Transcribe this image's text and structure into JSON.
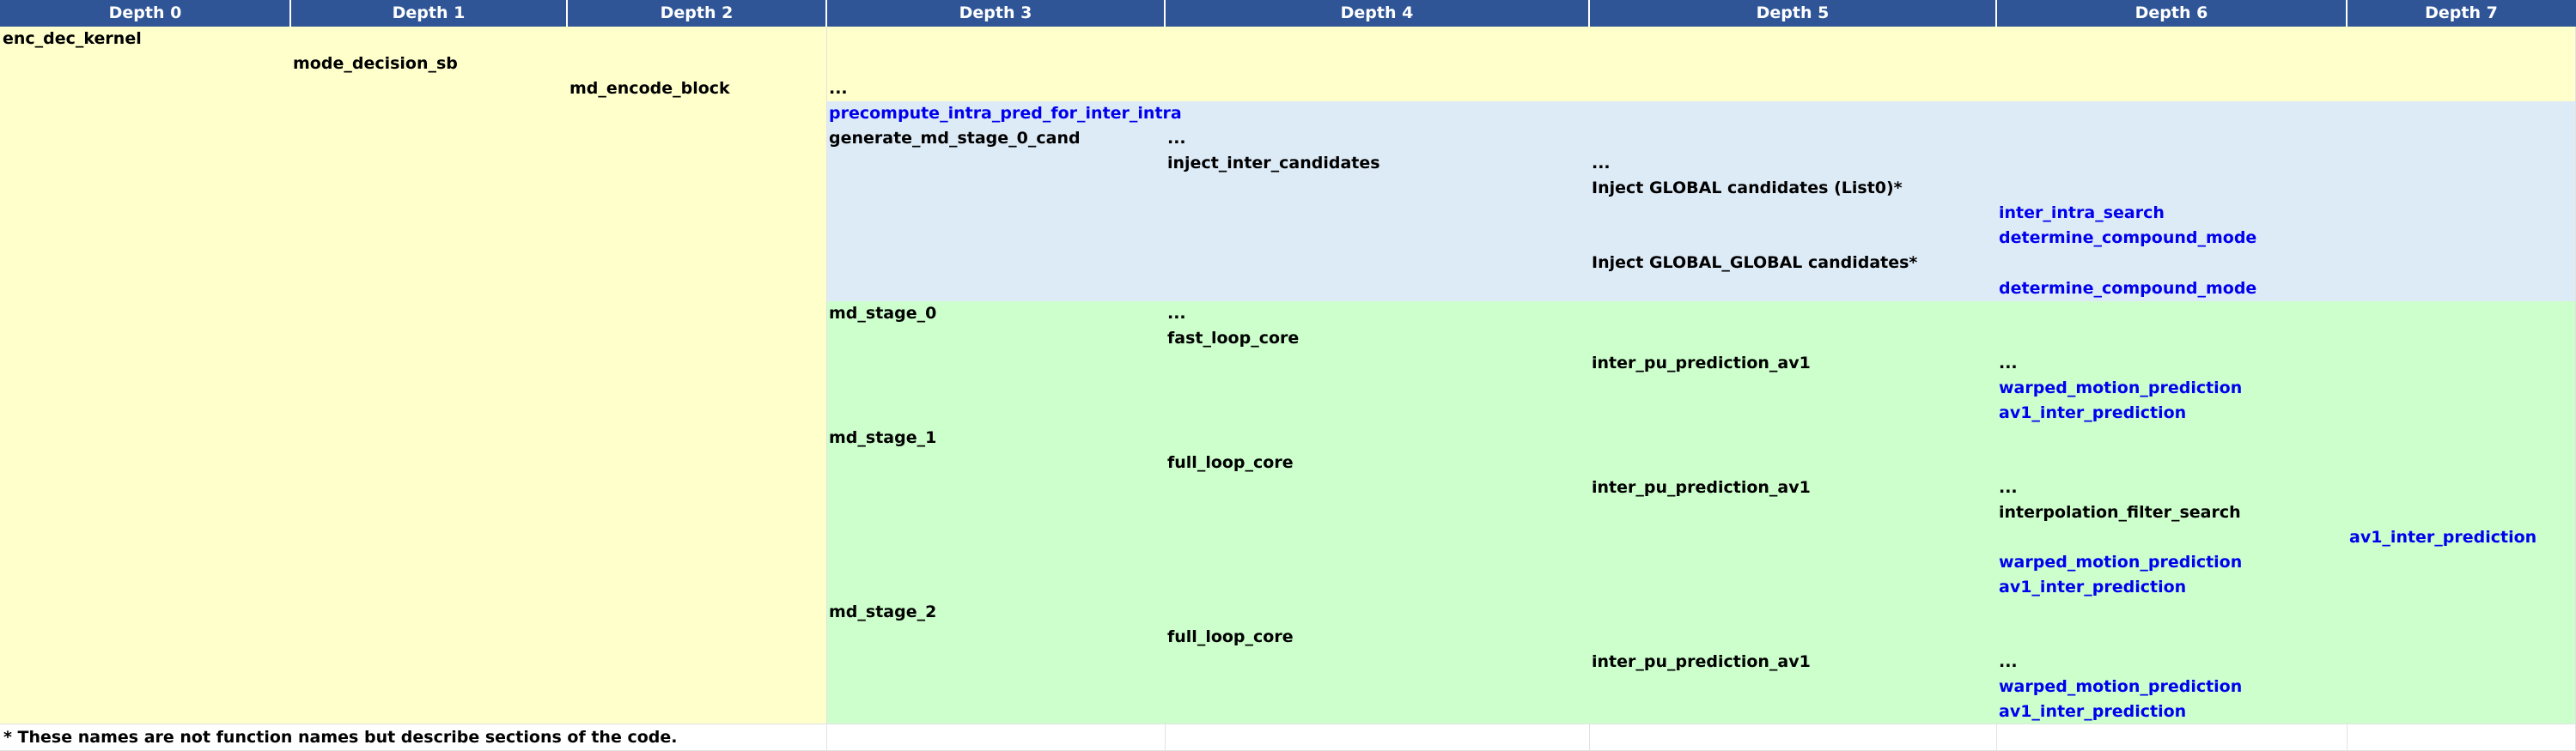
{
  "headers": [
    "Depth 0",
    "Depth 1",
    "Depth 2",
    "Depth 3",
    "Depth 4",
    "Depth 5",
    "Depth 6",
    "Depth 7"
  ],
  "colors": {
    "header_bg": "#2f5597",
    "header_text": "#ffffff",
    "yellow_bg": "#ffffcc",
    "blue_bg": "#ddebf7",
    "green_bg": "#ccffcc",
    "black_text": "#000000",
    "blue_text": "#0000ee"
  },
  "cells": [
    {
      "text": "enc_dec_kernel",
      "depth": 0,
      "row": 1,
      "color": "black"
    },
    {
      "text": "mode_decision_sb",
      "depth": 1,
      "row": 2,
      "color": "black"
    },
    {
      "text": "md_encode_block",
      "depth": 2,
      "row": 3,
      "color": "black"
    },
    {
      "text": "...",
      "depth": 3,
      "row": 3,
      "color": "black"
    },
    {
      "text": "precompute_intra_pred_for_inter_intra",
      "depth": 3,
      "row": 4,
      "color": "blue"
    },
    {
      "text": "generate_md_stage_0_cand",
      "depth": 3,
      "row": 5,
      "color": "black"
    },
    {
      "text": "...",
      "depth": 4,
      "row": 5,
      "color": "black"
    },
    {
      "text": "inject_inter_candidates",
      "depth": 4,
      "row": 6,
      "color": "black"
    },
    {
      "text": "...",
      "depth": 5,
      "row": 6,
      "color": "black"
    },
    {
      "text": "Inject GLOBAL candidates (List0)*",
      "depth": 5,
      "row": 7,
      "color": "black"
    },
    {
      "text": "inter_intra_search",
      "depth": 6,
      "row": 8,
      "color": "blue"
    },
    {
      "text": "determine_compound_mode",
      "depth": 6,
      "row": 9,
      "color": "blue"
    },
    {
      "text": "Inject GLOBAL_GLOBAL candidates*",
      "depth": 5,
      "row": 10,
      "color": "black"
    },
    {
      "text": "determine_compound_mode",
      "depth": 6,
      "row": 11,
      "color": "blue"
    },
    {
      "text": "md_stage_0",
      "depth": 3,
      "row": 12,
      "color": "black"
    },
    {
      "text": "...",
      "depth": 4,
      "row": 12,
      "color": "black"
    },
    {
      "text": "fast_loop_core",
      "depth": 4,
      "row": 13,
      "color": "black"
    },
    {
      "text": "inter_pu_prediction_av1",
      "depth": 5,
      "row": 14,
      "color": "black"
    },
    {
      "text": "...",
      "depth": 6,
      "row": 14,
      "color": "black"
    },
    {
      "text": "warped_motion_prediction",
      "depth": 6,
      "row": 15,
      "color": "blue"
    },
    {
      "text": "av1_inter_prediction",
      "depth": 6,
      "row": 16,
      "color": "blue"
    },
    {
      "text": "md_stage_1",
      "depth": 3,
      "row": 17,
      "color": "black"
    },
    {
      "text": "full_loop_core",
      "depth": 4,
      "row": 18,
      "color": "black"
    },
    {
      "text": "inter_pu_prediction_av1",
      "depth": 5,
      "row": 19,
      "color": "black"
    },
    {
      "text": "...",
      "depth": 6,
      "row": 19,
      "color": "black"
    },
    {
      "text": "interpolation_filter_search",
      "depth": 6,
      "row": 20,
      "color": "black"
    },
    {
      "text": "av1_inter_prediction",
      "depth": 7,
      "row": 21,
      "color": "blue"
    },
    {
      "text": "warped_motion_prediction",
      "depth": 6,
      "row": 22,
      "color": "blue"
    },
    {
      "text": "av1_inter_prediction",
      "depth": 6,
      "row": 23,
      "color": "blue"
    },
    {
      "text": "md_stage_2",
      "depth": 3,
      "row": 24,
      "color": "black"
    },
    {
      "text": "full_loop_core",
      "depth": 4,
      "row": 25,
      "color": "black"
    },
    {
      "text": "inter_pu_prediction_av1",
      "depth": 5,
      "row": 26,
      "color": "black"
    },
    {
      "text": "...",
      "depth": 6,
      "row": 26,
      "color": "black"
    },
    {
      "text": "warped_motion_prediction",
      "depth": 6,
      "row": 27,
      "color": "blue"
    },
    {
      "text": "av1_inter_prediction",
      "depth": 6,
      "row": 28,
      "color": "blue"
    }
  ],
  "footnote": "* These names are not function names but describe sections of the code."
}
